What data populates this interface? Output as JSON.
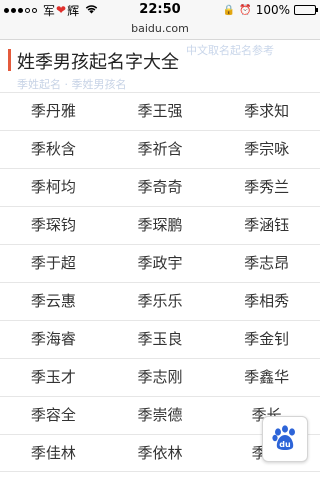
{
  "status_bar": {
    "carrier": "军",
    "carrier_suffix": "辉",
    "time": "22:50",
    "battery_pct": "100%",
    "battery_level": 1.0
  },
  "browser": {
    "url": "baidu.com"
  },
  "header": {
    "title": "姓季男孩起名字大全",
    "ghost_subtitle": "中文取名起名参考",
    "ghost_links": "季姓起名 · 季姓男孩名"
  },
  "names": [
    [
      "季丹雅",
      "季王强",
      "季求知"
    ],
    [
      "季秋含",
      "季祈含",
      "季宗咏"
    ],
    [
      "季柯均",
      "季奇奇",
      "季秀兰"
    ],
    [
      "季琛钧",
      "季琛鹏",
      "季涵钰"
    ],
    [
      "季于超",
      "季政宇",
      "季志昂"
    ],
    [
      "季云惠",
      "季乐乐",
      "季相秀"
    ],
    [
      "季海睿",
      "季玉良",
      "季金钊"
    ],
    [
      "季玉才",
      "季志刚",
      "季鑫华"
    ],
    [
      "季容全",
      "季崇德",
      "季长"
    ],
    [
      "季佳林",
      "季依林",
      "季仁"
    ]
  ],
  "fab": {
    "label": "du",
    "icon": "baidu-paw-icon"
  },
  "colors": {
    "accent": "#e45a3c",
    "baidu_blue": "#2d64d8"
  }
}
